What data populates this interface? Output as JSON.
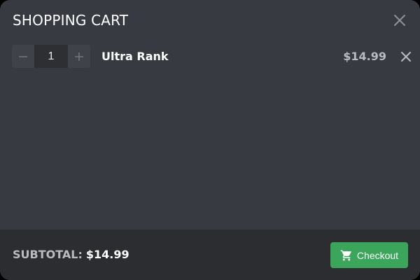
{
  "cart": {
    "title": "SHOPPING CART",
    "items": [
      {
        "quantity": "1",
        "name": "Ultra Rank",
        "price": "$14.99"
      }
    ],
    "subtotal_label": "SUBTOTAL:",
    "subtotal_value": "$14.99",
    "checkout_label": "Checkout"
  },
  "icons": {
    "close": "close-icon",
    "minus": "minus-icon",
    "plus": "plus-icon",
    "remove": "remove-icon",
    "cart": "cart-icon"
  },
  "colors": {
    "background": "#373a40",
    "footer": "#2b2d31",
    "accent": "#3ba55c",
    "muted_text": "#b9bbbe"
  }
}
